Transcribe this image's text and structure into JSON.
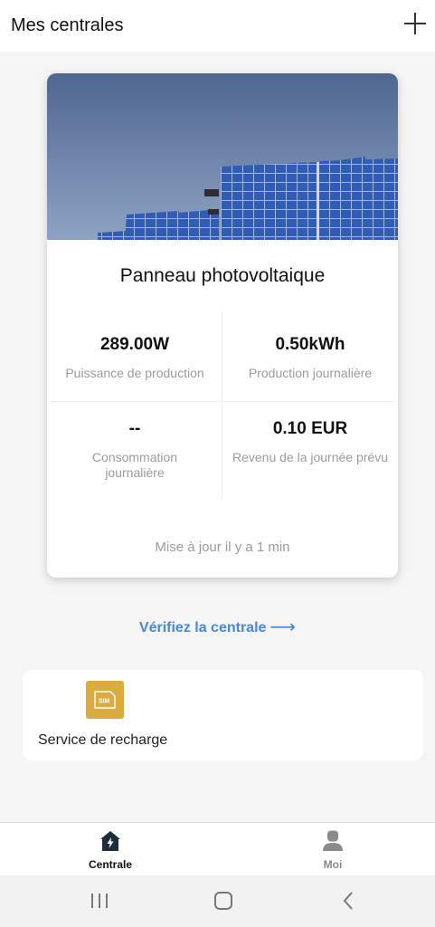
{
  "header": {
    "title": "Mes centrales"
  },
  "plant": {
    "name": "Panneau photovoltaique",
    "stats": [
      {
        "value": "289.00W",
        "label": "Puissance de production"
      },
      {
        "value": "0.50kWh",
        "label": "Production journalière"
      },
      {
        "value": "--",
        "label": "Consommation journalière"
      },
      {
        "value": "0.10 EUR",
        "label": "Revenu de la journée prévu"
      }
    ],
    "updated": "Mise à jour il y a 1 min"
  },
  "check_link": {
    "label": "Vérifiez la centrale",
    "arrow": "⟶"
  },
  "service": {
    "icon_text": "SIM",
    "label": "Service de recharge"
  },
  "bottom_nav": {
    "items": [
      {
        "label": "Centrale",
        "icon": "home-bolt-icon",
        "active": true
      },
      {
        "label": "Moi",
        "icon": "person-icon",
        "active": false
      }
    ]
  },
  "colors": {
    "accent": "#4a86d9",
    "sim": "#d9ac3d"
  }
}
